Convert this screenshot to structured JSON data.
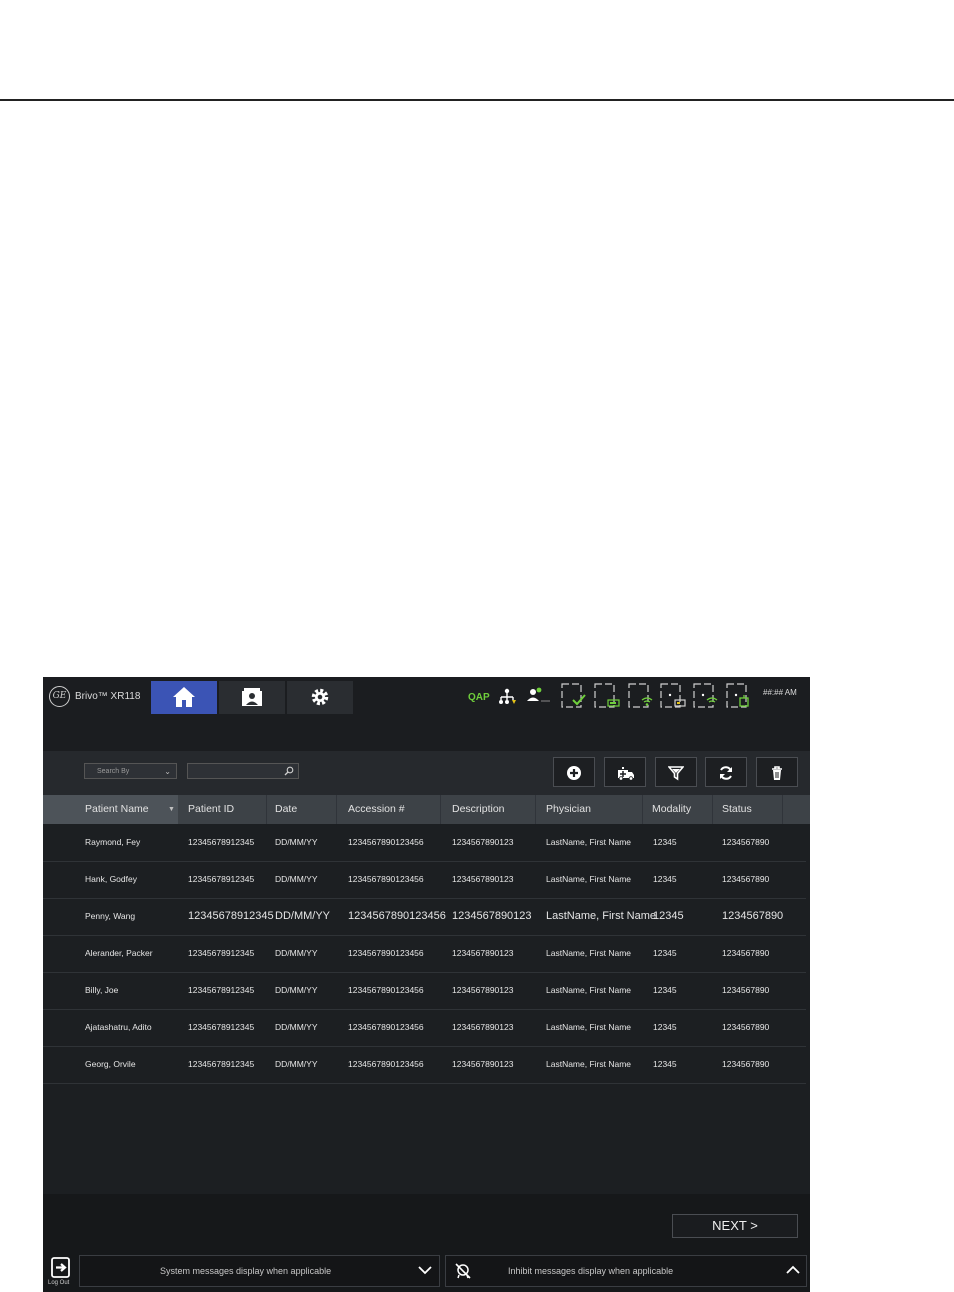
{
  "app": {
    "logo": "GE",
    "product_name": "Brivo™ XR118",
    "status": {
      "qap": "QAP",
      "clock": "##:## AM"
    },
    "nav_tabs": [
      {
        "name": "home",
        "icon": "home-icon"
      },
      {
        "name": "patient-worklist",
        "icon": "patient-card-icon"
      },
      {
        "name": "settings",
        "icon": "gear-icon"
      }
    ],
    "toolbar": {
      "search_by": "Search By",
      "search_value": "",
      "buttons": [
        "add-icon",
        "ambulance-icon",
        "filter-icon",
        "refresh-icon",
        "trash-icon"
      ]
    },
    "table": {
      "columns": [
        "Patient Name",
        "Patient ID",
        "Date",
        "Accession #",
        "Description",
        "Physician",
        "Modality",
        "Status"
      ],
      "rows": [
        [
          "Raymond, Fey",
          "12345678912345",
          "DD/MM/YY",
          "1234567890123456",
          "1234567890123",
          "LastName, First Name",
          "12345",
          "1234567890"
        ],
        [
          "Hank, Godfey",
          "12345678912345",
          "DD/MM/YY",
          "1234567890123456",
          "1234567890123",
          "LastName, First Name",
          "12345",
          "1234567890"
        ],
        [
          "Penny, Wang",
          "12345678912345",
          "DD/MM/YY",
          "1234567890123456",
          "1234567890123",
          "LastName, First Name",
          "12345",
          "1234567890"
        ],
        [
          "Alerander, Packer",
          "12345678912345",
          "DD/MM/YY",
          "1234567890123456",
          "1234567890123",
          "LastName, First Name",
          "12345",
          "1234567890"
        ],
        [
          "Billy, Joe",
          "12345678912345",
          "DD/MM/YY",
          "1234567890123456",
          "1234567890123",
          "LastName, First Name",
          "12345",
          "1234567890"
        ],
        [
          "Ajatashatru, Adito",
          "12345678912345",
          "DD/MM/YY",
          "1234567890123456",
          "1234567890123",
          "LastName, First Name",
          "12345",
          "1234567890"
        ],
        [
          "Georg, Orvile",
          "12345678912345",
          "DD/MM/YY",
          "1234567890123456",
          "1234567890123",
          "LastName, First Name",
          "12345",
          "1234567890"
        ]
      ]
    },
    "footer": {
      "next_label": "NEXT >",
      "logout_label": "Log Out",
      "system_messages": "System messages display when applicable",
      "inhibit_messages": "Inhibit messages display when applicable"
    },
    "colors": {
      "accent": "#3b54b5",
      "status_green": "#6fcf3b"
    }
  }
}
